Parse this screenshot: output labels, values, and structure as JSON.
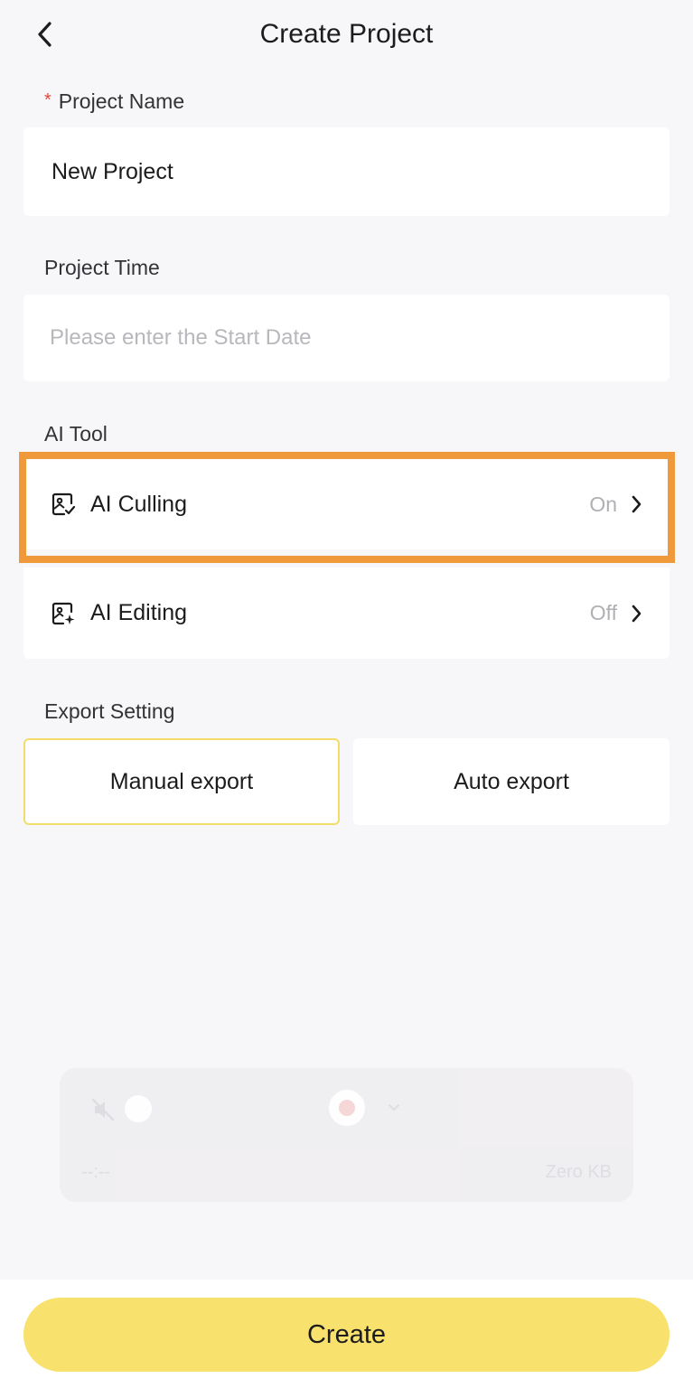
{
  "header": {
    "title": "Create Project"
  },
  "project_name": {
    "required_mark": "*",
    "label": "Project Name",
    "value": "New Project"
  },
  "project_time": {
    "label": "Project Time",
    "placeholder": "Please enter the Start Date",
    "value": ""
  },
  "ai_tool": {
    "label": "AI Tool",
    "items": [
      {
        "label": "AI Culling",
        "status": "On",
        "icon": "image-check-icon"
      },
      {
        "label": "AI Editing",
        "status": "Off",
        "icon": "image-sparkle-icon"
      }
    ]
  },
  "export_setting": {
    "label": "Export Setting",
    "options": [
      "Manual export",
      "Auto export"
    ],
    "selected": "Manual export"
  },
  "recorder": {
    "time": "--:--",
    "size": "Zero KB"
  },
  "footer": {
    "create_label": "Create"
  },
  "colors": {
    "accent_yellow": "#f8e16c",
    "highlight_orange": "#f0993b",
    "background": "#f7f6f9",
    "required_red": "#e04a3a"
  }
}
